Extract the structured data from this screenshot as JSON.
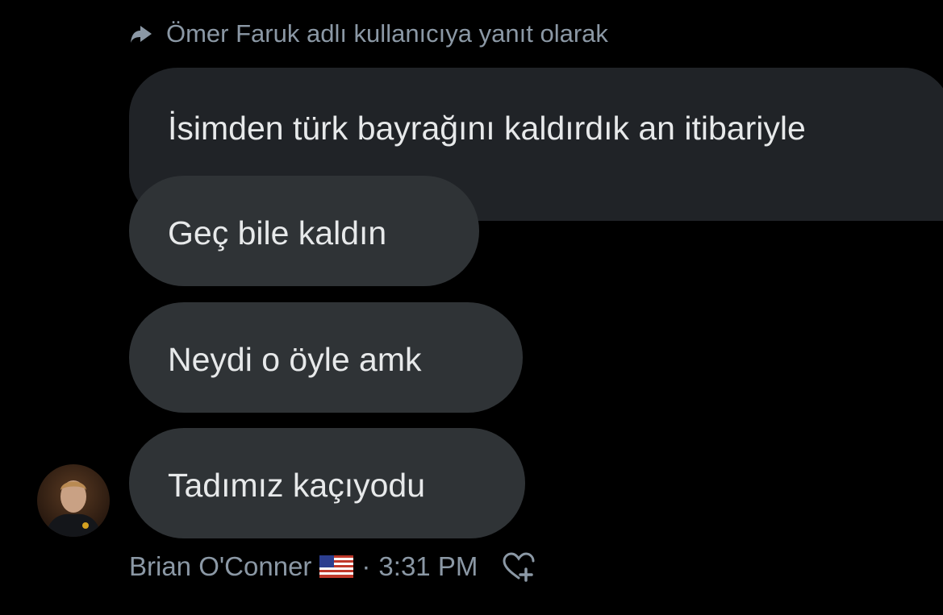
{
  "reply_context": {
    "text": "Ömer Faruk adlı kullanıcıya yanıt olarak",
    "icon": "reply-arrow-icon"
  },
  "messages": [
    {
      "text": "İsimden türk bayrağını kaldırdık an itibariyle",
      "direction": "received"
    },
    {
      "text": "Geç bile kaldın",
      "direction": "sent"
    },
    {
      "text": "Neydi o öyle amk",
      "direction": "sent"
    },
    {
      "text": "Tadımız kaçıyodu",
      "direction": "sent"
    }
  ],
  "sender": {
    "name": "Brian O'Conner",
    "flag": "us-flag-icon",
    "separator": "·",
    "time": "3:31 PM"
  },
  "actions": {
    "react_icon": "heart-add-icon"
  },
  "colors": {
    "background": "#000000",
    "bubble": "#2f3336",
    "bubble_received": "#202327",
    "text": "#e7e9ea",
    "muted": "#8b98a5"
  }
}
